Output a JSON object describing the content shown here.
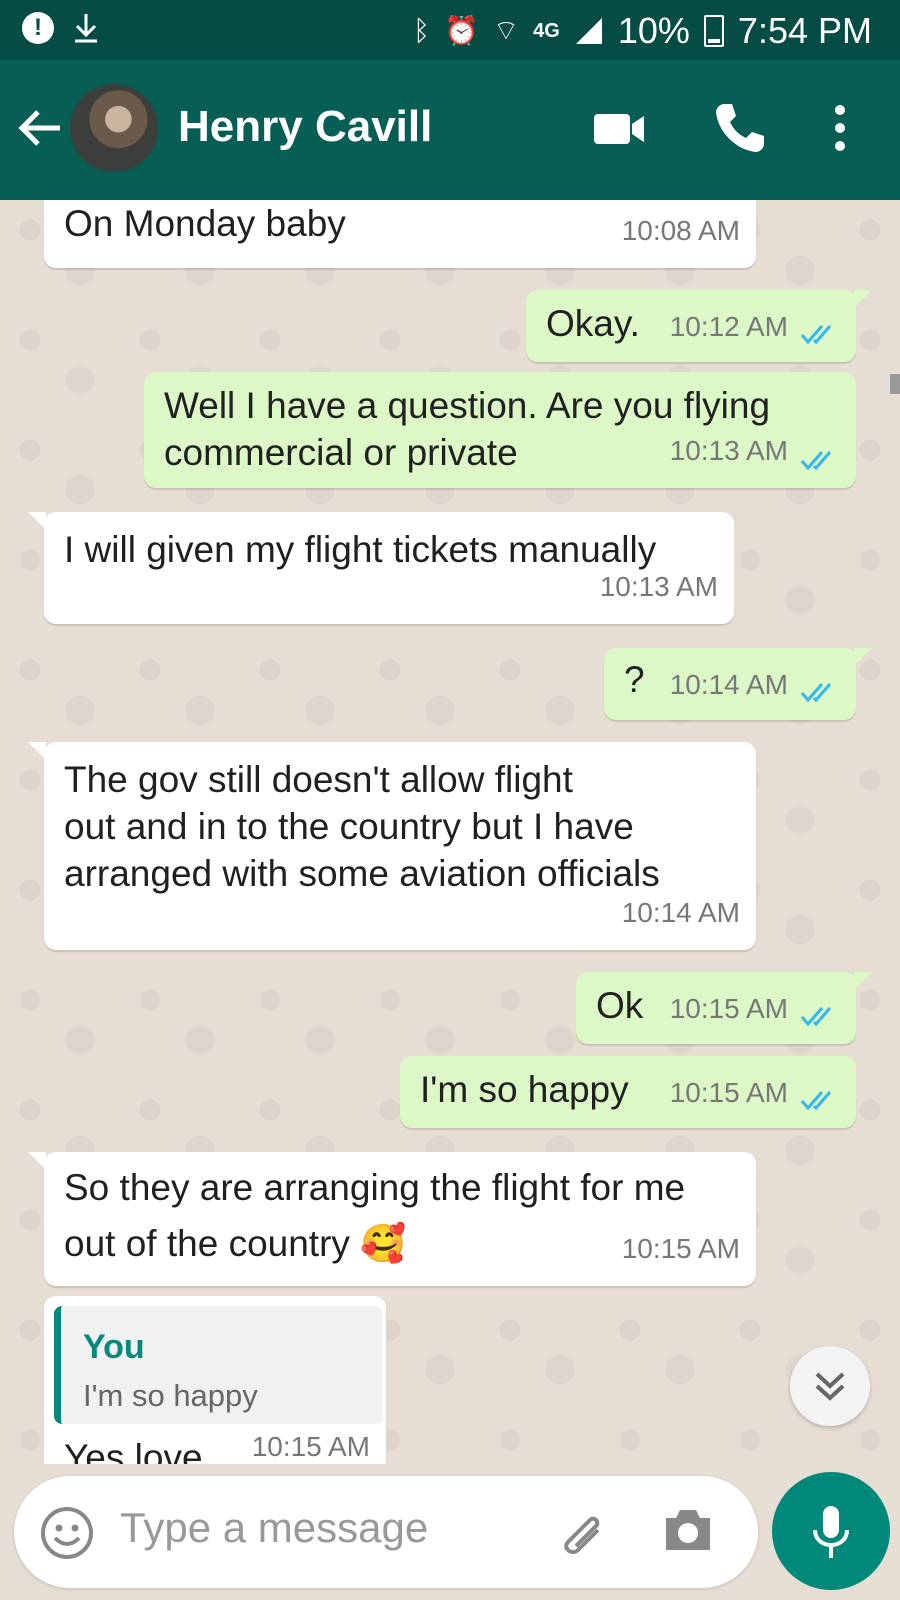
{
  "status_bar": {
    "network": "4G",
    "battery_percent": "10%",
    "time": "7:54 PM"
  },
  "header": {
    "contact_name": "Henry Cavill"
  },
  "messages": [
    {
      "direction": "in",
      "text": "On Monday baby",
      "time": "10:08 AM"
    },
    {
      "direction": "out",
      "text": "Okay.",
      "time": "10:12 AM",
      "read": true
    },
    {
      "direction": "out",
      "lines": [
        "Well I have a question. Are you flying",
        "commercial or private"
      ],
      "time": "10:13 AM",
      "read": true
    },
    {
      "direction": "in",
      "text": "I will given my flight tickets manually",
      "time": "10:13 AM"
    },
    {
      "direction": "out",
      "text": "?",
      "time": "10:14 AM",
      "read": true
    },
    {
      "direction": "in",
      "lines": [
        "The gov still doesn't allow flight",
        "out and in to the country but  I have",
        "arranged with some aviation officials"
      ],
      "time": "10:14 AM"
    },
    {
      "direction": "out",
      "text": "Ok",
      "time": "10:15 AM",
      "read": true
    },
    {
      "direction": "out",
      "text": "I'm so happy",
      "time": "10:15 AM",
      "read": true
    },
    {
      "direction": "in",
      "lines": [
        "So they are arranging the flight for me",
        "out of the country 🥰"
      ],
      "time": "10:15 AM"
    },
    {
      "direction": "in",
      "reply_to": {
        "author": "You",
        "text": "I'm so happy"
      },
      "text": "Yes love",
      "time": "10:15 AM"
    }
  ],
  "composer": {
    "placeholder": "Type a message"
  },
  "colors": {
    "header": "#075e54",
    "status_bar": "#054c44",
    "outgoing_bubble": "#dcf8c6",
    "incoming_bubble": "#ffffff",
    "read_ticks": "#34b7f1",
    "accent": "#00897b"
  },
  "icons": [
    "alert-icon",
    "download-icon",
    "bluetooth-icon",
    "alarm-icon",
    "wifi-icon",
    "signal-icon",
    "battery-icon",
    "back-arrow-icon",
    "video-call-icon",
    "phone-icon",
    "more-vert-icon",
    "double-check-icon",
    "scroll-down-icon",
    "emoji-icon",
    "attach-icon",
    "camera-icon",
    "mic-icon"
  ]
}
